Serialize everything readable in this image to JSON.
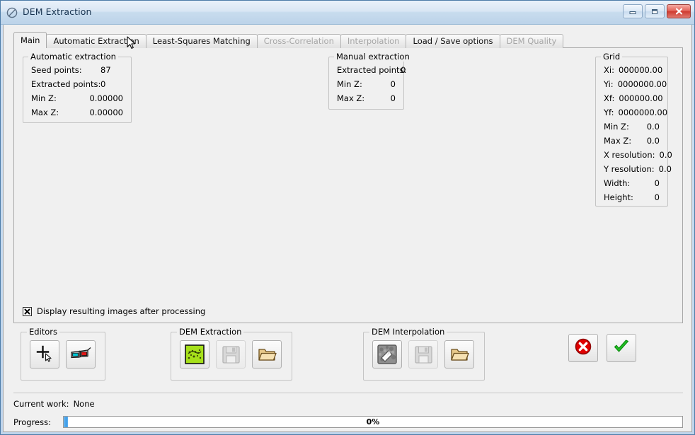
{
  "window": {
    "title": "DEM Extraction",
    "icon": "dem-app-icon",
    "controls": {
      "minimize": "minimize-button",
      "maximize": "maximize-button",
      "close": "close-button"
    }
  },
  "tabs": [
    {
      "label": "Main",
      "active": true,
      "disabled": false
    },
    {
      "label": "Automatic Extraction",
      "active": false,
      "disabled": false
    },
    {
      "label": "Least-Squares Matching",
      "active": false,
      "disabled": false
    },
    {
      "label": "Cross-Correlation",
      "active": false,
      "disabled": true
    },
    {
      "label": "Interpolation",
      "active": false,
      "disabled": true
    },
    {
      "label": "Load / Save options",
      "active": false,
      "disabled": false
    },
    {
      "label": "DEM Quality",
      "active": false,
      "disabled": true
    }
  ],
  "automatic_extraction": {
    "legend": "Automatic extraction",
    "rows": [
      {
        "key": "Seed points:",
        "value": "87"
      },
      {
        "key": "Extracted points:",
        "value": "0"
      },
      {
        "key": "Min Z:",
        "value": "0.00000"
      },
      {
        "key": "Max Z:",
        "value": "0.00000"
      }
    ]
  },
  "manual_extraction": {
    "legend": "Manual extraction",
    "rows": [
      {
        "key": "Extracted points:",
        "value": "0"
      },
      {
        "key": "Min Z:",
        "value": "0"
      },
      {
        "key": "Max Z:",
        "value": "0"
      }
    ]
  },
  "grid": {
    "legend": "Grid",
    "rows": [
      {
        "key": "Xi:",
        "value": "000000.00"
      },
      {
        "key": "Yi:",
        "value": "0000000.00"
      },
      {
        "key": "Xf:",
        "value": "000000.00"
      },
      {
        "key": "Yf:",
        "value": "0000000.00"
      },
      {
        "key": "Min Z:",
        "value": "0.0"
      },
      {
        "key": "Max Z:",
        "value": "0.0"
      },
      {
        "key": "X resolution:",
        "value": "0.0"
      },
      {
        "key": "Y resolution:",
        "value": "0.0"
      },
      {
        "key": "Width:",
        "value": "0"
      },
      {
        "key": "Height:",
        "value": "0"
      }
    ]
  },
  "display_option": {
    "label": "Display resulting images after processing",
    "checked": true
  },
  "editors": {
    "legend": "Editors",
    "buttons": [
      {
        "icon": "add-point-cursor-icon",
        "disabled": false
      },
      {
        "icon": "anaglyph-glasses-icon",
        "disabled": false
      }
    ]
  },
  "dem_extraction": {
    "legend": "DEM Extraction",
    "buttons": [
      {
        "icon": "terrain-extract-icon",
        "disabled": false
      },
      {
        "icon": "floppy-save-icon",
        "disabled": true
      },
      {
        "icon": "open-folder-icon",
        "disabled": false
      }
    ]
  },
  "dem_interpolation": {
    "legend": "DEM Interpolation",
    "buttons": [
      {
        "icon": "grayscale-dem-icon",
        "disabled": false
      },
      {
        "icon": "floppy-save-icon",
        "disabled": true
      },
      {
        "icon": "open-folder-icon",
        "disabled": false
      }
    ]
  },
  "actions": {
    "cancel": {
      "icon": "cancel-x-icon"
    },
    "ok": {
      "icon": "ok-check-icon"
    }
  },
  "status": {
    "work_label": "Current work:",
    "work_value": "None",
    "progress_label": "Progress:",
    "progress_text": "0%",
    "progress_percent": 0
  },
  "colors": {
    "accent_blue": "#3d9ce8",
    "close_red": "#cf3b30",
    "ok_green": "#22c024",
    "cancel_red": "#e00000",
    "terrain_green": "#a6e01a",
    "folder_tan": "#e8c98a",
    "window_border": "#4d7ca8",
    "panel_bg": "#f0f0f0"
  }
}
